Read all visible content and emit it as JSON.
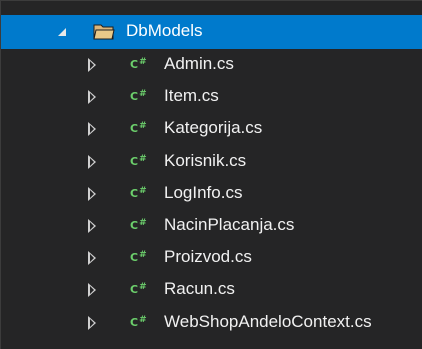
{
  "folder": {
    "label": "DbModels",
    "icon": "folder-open-icon"
  },
  "file_icon": {
    "text": "C",
    "sup": "#",
    "name": "csharp-file-icon",
    "color": "#6ccf6c"
  },
  "files": [
    {
      "label": "Admin.cs"
    },
    {
      "label": "Item.cs"
    },
    {
      "label": "Kategorija.cs"
    },
    {
      "label": "Korisnik.cs"
    },
    {
      "label": "LogInfo.cs"
    },
    {
      "label": "NacinPlacanja.cs"
    },
    {
      "label": "Proizvod.cs"
    },
    {
      "label": "Racun.cs"
    },
    {
      "label": "WebShopAndeloContext.cs"
    }
  ],
  "colors": {
    "background": "#252526",
    "selection": "#007acc",
    "folder": "#dcb67a",
    "text": "#f1f1f1"
  }
}
